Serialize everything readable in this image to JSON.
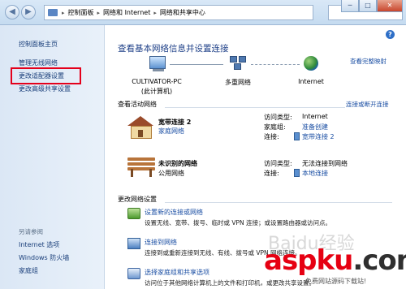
{
  "address_bar": {
    "crumbs": [
      "控制面板",
      "网络和 Internet",
      "网络和共享中心"
    ]
  },
  "window_buttons": {
    "minimize": "─",
    "maximize": "□",
    "close": "✕"
  },
  "sidebar": {
    "home": "控制面板主页",
    "items": [
      "管理无线网络",
      "更改适配器设置",
      "更改高级共享设置"
    ],
    "see_also_label": "另请参阅",
    "see_also": [
      "Internet 选项",
      "Windows 防火墙",
      "家庭组"
    ]
  },
  "main": {
    "help": "?",
    "title": "查看基本网络信息并设置连接",
    "full_map_link": "查看完整映射",
    "nodes": [
      {
        "name": "CULTIVATOR-PC",
        "sub": "(此计算机)"
      },
      {
        "name": "多重网络",
        "sub": ""
      },
      {
        "name": "Internet",
        "sub": ""
      }
    ],
    "active_heading": "查看活动网络",
    "connect_link": "连接或断开连接",
    "networks": [
      {
        "name": "宽带连接 2",
        "type": "家庭网络",
        "access_type_label": "访问类型:",
        "access_type": "Internet",
        "homegroup_label": "家庭组:",
        "homegroup": "准备创建",
        "connection_label": "连接:",
        "connection": "宽带连接 2"
      },
      {
        "name": "未识别的网络",
        "type": "公用网络",
        "access_type_label": "访问类型:",
        "access_type": "无法连接到网络",
        "connection_label": "连接:",
        "connection": "本地连接"
      }
    ],
    "change_heading": "更改网络设置",
    "tasks": [
      {
        "link": "设置新的连接或网络",
        "desc": "设置无线、宽带、拨号、临时或 VPN 连接；或设置路由器或访问点。"
      },
      {
        "link": "连接到网络",
        "desc": "连接到或重新连接到无线、有线、拨号或 VPN 网络连接。"
      },
      {
        "link": "选择家庭组和共享选项",
        "desc": "访问位于其他网络计算机上的文件和打印机，或更改共享设置。"
      }
    ]
  },
  "watermark": {
    "part1": "asp",
    "part2": "ku",
    "part3": ".com",
    "sub": "免费网站源码下载站!",
    "bg": "Baidu经验"
  },
  "colors": {
    "highlight": "#e4001b",
    "link": "#1a4ea3",
    "title": "#1d3f87"
  }
}
